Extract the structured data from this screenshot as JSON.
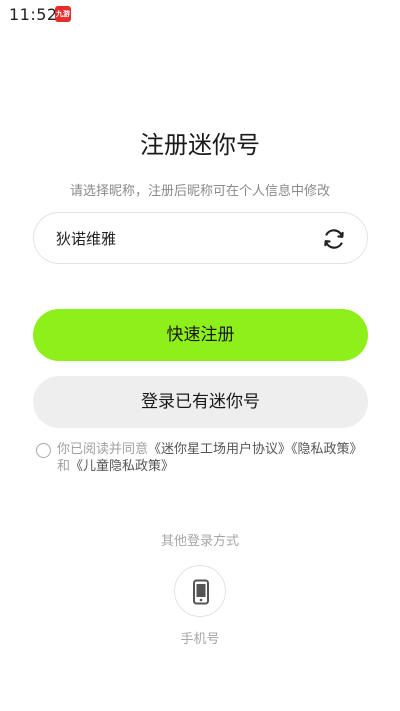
{
  "status_bar": {
    "time": "11:52",
    "app_badge": "九游"
  },
  "header": {
    "title": "注册迷你号",
    "subtitle": "请选择昵称，注册后昵称可在个人信息中修改"
  },
  "nickname": {
    "value": "狄诺维雅",
    "refresh_icon": "refresh-icon"
  },
  "buttons": {
    "quick_register": "快速注册",
    "login_existing": "登录已有迷你号"
  },
  "agreement": {
    "prefix": "你已阅读并同意",
    "user_agreement": "《迷你星工场用户协议》",
    "privacy_policy": "《隐私政策》",
    "and": "和",
    "child_privacy": "《儿童隐私政策》",
    "checked": false
  },
  "other_login": {
    "label": "其他登录方式",
    "phone_label": "手机号",
    "phone_icon": "phone-icon"
  },
  "colors": {
    "primary": "#8ef01a",
    "secondary": "#eeeeee"
  }
}
